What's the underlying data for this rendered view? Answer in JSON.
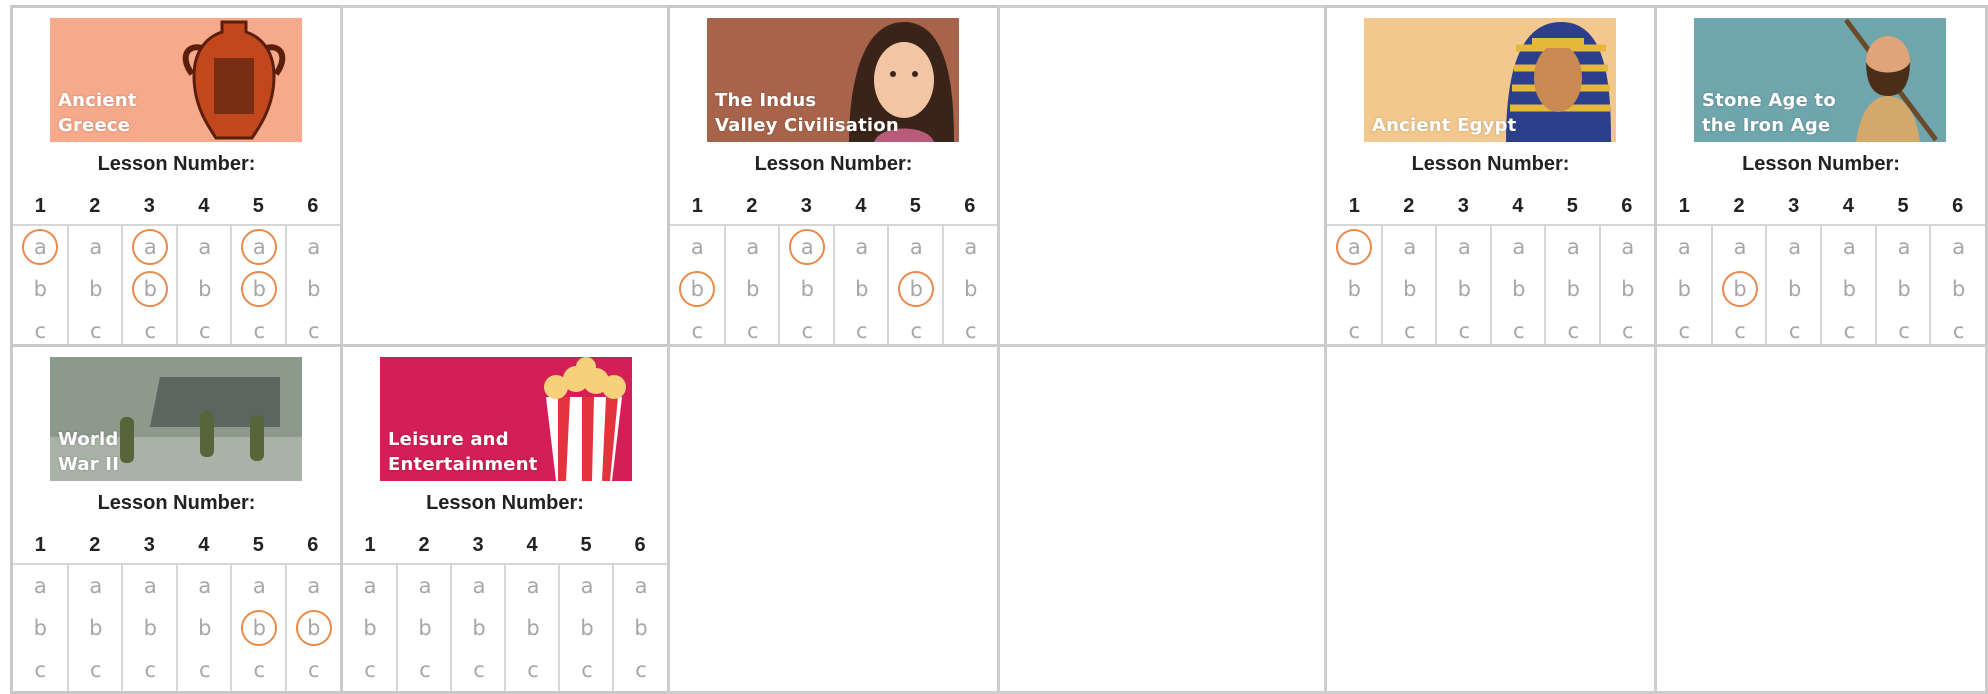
{
  "lesson_label": "Lesson Number:",
  "cards": [
    {
      "title": "Ancient\nGreece",
      "icon": "greek-amphora-icon",
      "banner_color": "#f6a98b",
      "lessons": [
        "1",
        "2",
        "3",
        "4",
        "5",
        "6"
      ],
      "options": [
        "a",
        "b",
        "c"
      ],
      "circled": [
        [
          "a"
        ],
        [],
        [
          "a",
          "b"
        ],
        [],
        [
          "a",
          "b"
        ],
        []
      ]
    },
    {
      "title": "The Indus\nValley Civilisation",
      "icon": "indus-woman-portrait-icon",
      "banner_color": "#a8644a",
      "lessons": [
        "1",
        "2",
        "3",
        "4",
        "5",
        "6"
      ],
      "options": [
        "a",
        "b",
        "c"
      ],
      "circled": [
        [
          "b"
        ],
        [],
        [
          "a"
        ],
        [],
        [
          "b"
        ],
        []
      ]
    },
    {
      "title": "Ancient Egypt",
      "icon": "pharaoh-icon",
      "banner_color": "#f2c88f",
      "lessons": [
        "1",
        "2",
        "3",
        "4",
        "5",
        "6"
      ],
      "options": [
        "a",
        "b",
        "c"
      ],
      "circled": [
        [
          "a"
        ],
        [],
        [],
        [],
        [],
        []
      ]
    },
    {
      "title": "Stone Age to\nthe Iron Age",
      "icon": "caveman-spear-icon",
      "banner_color": "#6fa6ad",
      "lessons": [
        "1",
        "2",
        "3",
        "4",
        "5",
        "6"
      ],
      "options": [
        "a",
        "b",
        "c"
      ],
      "circled": [
        [],
        [
          "b"
        ],
        [],
        [],
        [],
        []
      ]
    },
    {
      "title": "World\nWar II",
      "icon": "soldiers-landing-craft-icon",
      "banner_color": "#8c9a8c",
      "lessons": [
        "1",
        "2",
        "3",
        "4",
        "5",
        "6"
      ],
      "options": [
        "a",
        "b",
        "c"
      ],
      "circled": [
        [],
        [],
        [],
        [],
        [
          "b"
        ],
        [
          "b"
        ]
      ]
    },
    {
      "title": "Leisure and\nEntertainment",
      "icon": "popcorn-icon",
      "banner_color": "#d41e57",
      "lessons": [
        "1",
        "2",
        "3",
        "4",
        "5",
        "6"
      ],
      "options": [
        "a",
        "b",
        "c"
      ],
      "circled": [
        [],
        [],
        [],
        [],
        [],
        []
      ]
    }
  ]
}
